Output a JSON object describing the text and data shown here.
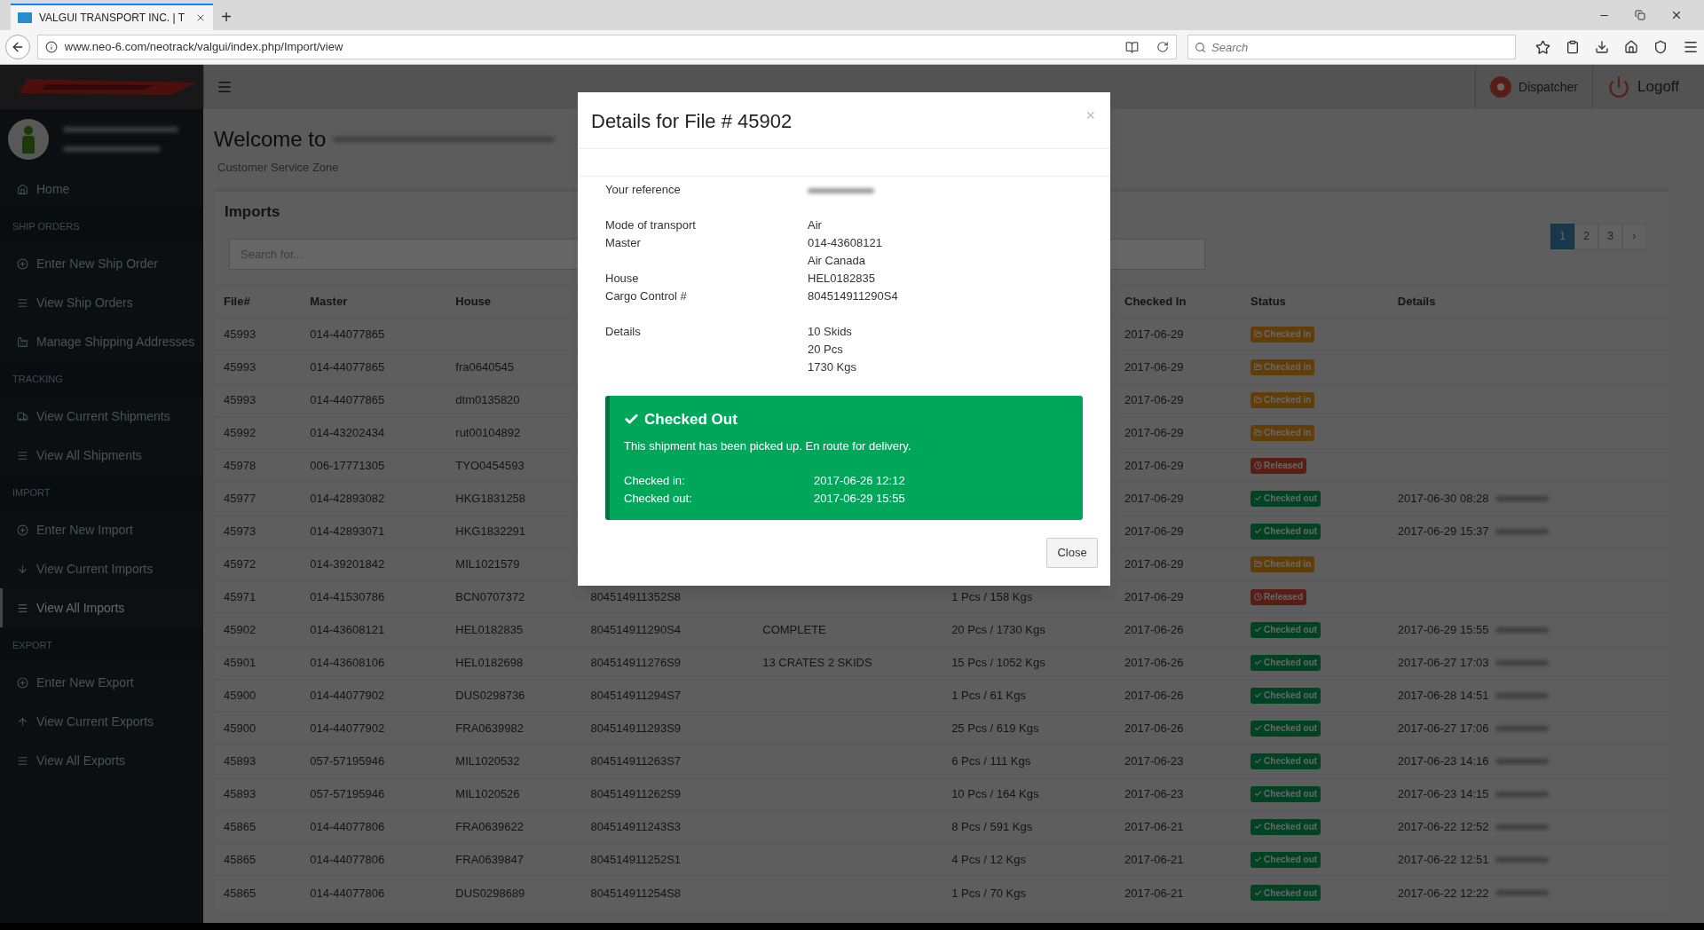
{
  "browser": {
    "tab_title": "VALGUI TRANSPORT INC. | T",
    "new_tab": "+",
    "url": "www.neo-6.com/neotrack/valgui/index.php/Import/view",
    "search": {
      "placeholder": "Search"
    }
  },
  "header": {
    "user": "Dispatcher",
    "logoff": "Logoff"
  },
  "sidebar": {
    "items": [
      {
        "kind": "link",
        "label": "Home",
        "selected": false
      },
      {
        "kind": "section",
        "label": "SHIP ORDERS"
      },
      {
        "kind": "link",
        "label": "Enter New Ship Order",
        "selected": false
      },
      {
        "kind": "link",
        "label": "View Ship Orders",
        "selected": false
      },
      {
        "kind": "link",
        "label": "Manage Shipping Addresses",
        "selected": false
      },
      {
        "kind": "section",
        "label": "TRACKING"
      },
      {
        "kind": "link",
        "label": "View Current Shipments",
        "selected": false
      },
      {
        "kind": "link",
        "label": "View All Shipments",
        "selected": false
      },
      {
        "kind": "section",
        "label": "IMPORT"
      },
      {
        "kind": "link",
        "label": "Enter New Import",
        "selected": false
      },
      {
        "kind": "link",
        "label": "View Current Imports",
        "selected": false
      },
      {
        "kind": "link",
        "label": "View All Imports",
        "selected": true
      },
      {
        "kind": "section",
        "label": "EXPORT"
      },
      {
        "kind": "link",
        "label": "Enter New Export",
        "selected": false
      },
      {
        "kind": "link",
        "label": "View Current Exports",
        "selected": false
      },
      {
        "kind": "link",
        "label": "View All Exports",
        "selected": false
      }
    ]
  },
  "page": {
    "title": "Welcome to",
    "subtitle": "Customer Service Zone"
  },
  "panel": {
    "title": "Imports",
    "search": {
      "placeholder": "Search for..."
    },
    "pagination": [
      {
        "label": "1",
        "selected": true
      },
      {
        "label": "2",
        "selected": false
      },
      {
        "label": "3",
        "selected": false
      },
      {
        "label": "›",
        "selected": false
      }
    ]
  },
  "table": {
    "columns_left": [
      "File#",
      "Master",
      "House"
    ],
    "columns_right": [
      "Checked In",
      "Status",
      "Details"
    ],
    "rows": [
      {
        "file": "45993",
        "master": "014-44077865",
        "checked_in": "2017-06-29",
        "status": {
          "kind": "checked_in",
          "label": "Checked in"
        }
      },
      {
        "file": "45993",
        "master": "014-44077865",
        "house": "fra0640545",
        "checked_in": "2017-06-29",
        "status": {
          "kind": "checked_in",
          "label": "Checked in"
        }
      },
      {
        "file": "45993",
        "master": "014-44077865",
        "house": "dtm0135820",
        "checked_in": "2017-06-29",
        "status": {
          "kind": "checked_in",
          "label": "Checked in"
        }
      },
      {
        "file": "45992",
        "master": "014-43202434",
        "house": "rut00104892",
        "checked_in": "2017-06-29",
        "status": {
          "kind": "checked_in",
          "label": "Checked in"
        }
      },
      {
        "file": "45978",
        "master": "006-17771305",
        "house": "TYO0454593",
        "checked_in": "2017-06-29",
        "status": {
          "kind": "released",
          "label": "Released"
        }
      },
      {
        "file": "45977",
        "master": "014-42893082",
        "house": "HKG1831258",
        "checked_in": "2017-06-29",
        "status": {
          "kind": "checked_out",
          "label": "Checked out"
        },
        "details": "2017-06-30 08:28"
      },
      {
        "file": "45973",
        "master": "014-42893071",
        "house": "HKG1832291",
        "checked_in": "2017-06-29",
        "status": {
          "kind": "checked_out",
          "label": "Checked out"
        },
        "details": "2017-06-29 15:37"
      },
      {
        "file": "45972",
        "master": "014-39201842",
        "house": "MIL1021579",
        "checked_in": "2017-06-29",
        "status": {
          "kind": "checked_in",
          "label": "Checked in"
        }
      },
      {
        "file": "45971",
        "master": "014-41530786",
        "house": "BCN0707372",
        "column_4": "804514911352S8",
        "column_6": "1 Pcs / 158 Kgs",
        "checked_in": "2017-06-29",
        "status": {
          "kind": "released",
          "label": "Released"
        }
      },
      {
        "file": "45902",
        "master": "014-43608121",
        "house": "HEL0182835",
        "column_4": "804514911290S4",
        "column_5": "COMPLETE",
        "column_6": "20 Pcs / 1730 Kgs",
        "checked_in": "2017-06-26",
        "status": {
          "kind": "checked_out",
          "label": "Checked out"
        },
        "details": "2017-06-29 15:55"
      },
      {
        "file": "45901",
        "master": "014-43608106",
        "house": "HEL0182698",
        "column_4": "804514911276S9",
        "column_5": "13 CRATES 2 SKIDS",
        "column_6": "15 Pcs / 1052 Kgs",
        "checked_in": "2017-06-26",
        "status": {
          "kind": "checked_out",
          "label": "Checked out"
        },
        "details": "2017-06-27 17:03"
      },
      {
        "file": "45900",
        "master": "014-44077902",
        "house": "DUS0298736",
        "column_4": "804514911294S7",
        "column_6": "1 Pcs / 61 Kgs",
        "checked_in": "2017-06-26",
        "status": {
          "kind": "checked_out",
          "label": "Checked out"
        },
        "details": "2017-06-28 14:51"
      },
      {
        "file": "45900",
        "master": "014-44077902",
        "house": "FRA0639982",
        "column_4": "804514911293S9",
        "column_6": "25 Pcs / 619 Kgs",
        "checked_in": "2017-06-26",
        "status": {
          "kind": "checked_out",
          "label": "Checked out"
        },
        "details": "2017-06-27 17:06"
      },
      {
        "file": "45893",
        "master": "057-57195946",
        "house": "MIL1020532",
        "column_4": "804514911263S7",
        "column_6": "6 Pcs / 111 Kgs",
        "checked_in": "2017-06-23",
        "status": {
          "kind": "checked_out",
          "label": "Checked out"
        },
        "details": "2017-06-23 14:16"
      },
      {
        "file": "45893",
        "master": "057-57195946",
        "house": "MIL1020526",
        "column_4": "804514911262S9",
        "column_6": "10 Pcs / 164 Kgs",
        "checked_in": "2017-06-23",
        "status": {
          "kind": "checked_out",
          "label": "Checked out"
        },
        "details": "2017-06-23 14:15"
      },
      {
        "file": "45865",
        "master": "014-44077806",
        "house": "FRA0639622",
        "column_4": "804514911243S3",
        "column_6": "8 Pcs / 591 Kgs",
        "checked_in": "2017-06-21",
        "status": {
          "kind": "checked_out",
          "label": "Checked out"
        },
        "details": "2017-06-22 12:52"
      },
      {
        "file": "45865",
        "master": "014-44077806",
        "house": "FRA0639847",
        "column_4": "804514911252S1",
        "column_6": "4 Pcs / 12 Kgs",
        "checked_in": "2017-06-21",
        "status": {
          "kind": "checked_out",
          "label": "Checked out"
        },
        "details": "2017-06-22 12:51"
      },
      {
        "file": "45865",
        "master": "014-44077806",
        "house": "DUS0298689",
        "column_4": "804514911254S8",
        "column_6": "1 Pcs / 70 Kgs",
        "checked_in": "2017-06-21",
        "status": {
          "kind": "checked_out",
          "label": "Checked out"
        },
        "details": "2017-06-22 12:22"
      }
    ]
  },
  "modal": {
    "title": "Details for File # 45902",
    "close_symbol": "×",
    "groups": [
      [
        {
          "label": "Your reference",
          "redacted": true
        }
      ],
      [
        {
          "label": "Mode of transport",
          "value": "Air"
        },
        {
          "label": "Master",
          "value": "014-43608121"
        },
        {
          "value": "Air Canada"
        },
        {
          "label": "House",
          "value": "HEL0182835"
        },
        {
          "label": "Cargo Control #",
          "value": "804514911290S4"
        }
      ],
      [
        {
          "label": "Details",
          "value": "10 Skids"
        },
        {
          "value": "20 Pcs"
        },
        {
          "value": "1730 Kgs"
        }
      ]
    ],
    "alert": {
      "kind": "success",
      "title": "Checked Out",
      "message": "This shipment has been picked up. En route for delivery.",
      "times": [
        {
          "label": "Checked in:",
          "value": "2017-06-26 12:12"
        },
        {
          "label": "Checked out:",
          "value": "2017-06-29 15:55"
        }
      ]
    },
    "close_button": "Close"
  }
}
